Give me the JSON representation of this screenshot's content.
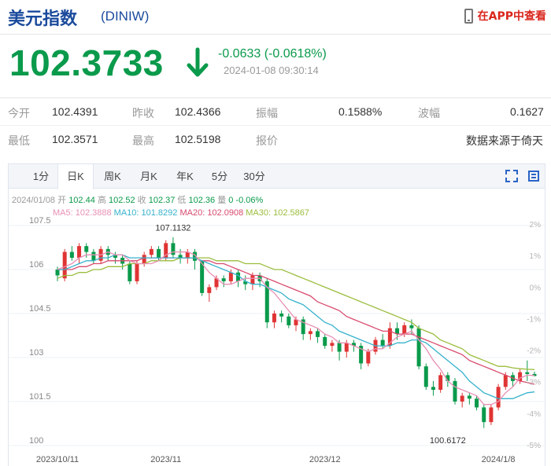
{
  "header": {
    "title": "美元指数",
    "code": "(DINIW)",
    "app_link": "在APP中查看"
  },
  "quote": {
    "price": "102.3733",
    "change": "-0.0633 (-0.0618%)",
    "time": "2024-01-08 09:30:14"
  },
  "stats": [
    {
      "label": "今开",
      "value": "102.4391"
    },
    {
      "label": "昨收",
      "value": "102.4366"
    },
    {
      "label": "振幅",
      "value": "0.1588%"
    },
    {
      "label": "波幅",
      "value": "0.1627"
    },
    {
      "label": "最低",
      "value": "102.3571"
    },
    {
      "label": "最高",
      "value": "102.5198"
    },
    {
      "label": "报价",
      "value": ""
    },
    {
      "label": "",
      "value": "数据来源于倚天"
    }
  ],
  "tabs": [
    "1分",
    "日K",
    "周K",
    "月K",
    "年K",
    "5分",
    "30分"
  ],
  "active_tab": "日K",
  "colors": {
    "up": "#e03434",
    "down": "#0a9a4b",
    "ma5": "#e88fb4",
    "ma10": "#35b2cc",
    "ma20": "#d94a6e",
    "ma30": "#9bbd3d"
  },
  "chart_data": {
    "type": "candlestick",
    "info_date": "2024/01/08",
    "info_items": [
      {
        "label": "开",
        "value": "102.44"
      },
      {
        "label": "高",
        "value": "102.52"
      },
      {
        "label": "收",
        "value": "102.37"
      },
      {
        "label": "低",
        "value": "102.36"
      },
      {
        "label": "量",
        "value": "0"
      },
      {
        "label": "",
        "value": "-0.06%"
      }
    ],
    "ma_labels": [
      {
        "name": "MA5",
        "value": "102.3888"
      },
      {
        "name": "MA10",
        "value": "101.8292"
      },
      {
        "name": "MA20",
        "value": "102.0908"
      },
      {
        "name": "MA30",
        "value": "102.5867"
      }
    ],
    "y_ticks": [
      "107.5",
      "106",
      "104.5",
      "103",
      "101.5",
      "100"
    ],
    "y_tick_values": [
      107.5,
      106,
      104.5,
      103,
      101.5,
      100
    ],
    "pct_ticks": [
      "2%",
      "1%",
      "0%",
      "-1%",
      "-2%",
      "-3%",
      "-4%",
      "-5%"
    ],
    "x_ticks": [
      {
        "label": "2023/10/11",
        "index": 0
      },
      {
        "label": "2023/11",
        "index": 15
      },
      {
        "label": "2023/12",
        "index": 37
      },
      {
        "label": "2024/1/8",
        "index": 61
      }
    ],
    "ylim": [
      100,
      107.5
    ],
    "annotations": [
      {
        "label": "107.1132",
        "index": 16,
        "value": 107.11
      },
      {
        "label": "100.6172",
        "index": 54,
        "value": 100.62
      }
    ],
    "candles": [
      [
        106.0,
        105.8,
        106.1,
        105.6
      ],
      [
        105.7,
        106.6,
        106.7,
        105.6
      ],
      [
        106.6,
        106.4,
        106.8,
        106.3
      ],
      [
        106.4,
        106.8,
        106.9,
        106.2
      ],
      [
        106.8,
        106.6,
        106.9,
        106.4
      ],
      [
        106.6,
        106.3,
        106.7,
        106.2
      ],
      [
        106.3,
        106.7,
        106.8,
        106.2
      ],
      [
        106.7,
        106.5,
        106.8,
        106.3
      ],
      [
        106.5,
        106.4,
        106.6,
        106.2
      ],
      [
        106.4,
        106.2,
        106.5,
        106.0
      ],
      [
        106.2,
        105.6,
        106.3,
        105.5
      ],
      [
        105.6,
        106.2,
        106.3,
        105.5
      ],
      [
        106.2,
        106.5,
        106.6,
        106.1
      ],
      [
        106.5,
        106.7,
        106.8,
        106.4
      ],
      [
        106.7,
        106.4,
        106.8,
        106.3
      ],
      [
        106.4,
        106.9,
        107.0,
        106.3
      ],
      [
        106.9,
        106.5,
        107.1,
        106.4
      ],
      [
        106.5,
        106.4,
        106.7,
        106.2
      ],
      [
        106.4,
        106.6,
        106.7,
        106.2
      ],
      [
        106.6,
        106.3,
        106.7,
        106.0
      ],
      [
        106.3,
        105.2,
        106.3,
        105.1
      ],
      [
        105.2,
        105.4,
        105.5,
        104.9
      ],
      [
        105.4,
        105.7,
        105.8,
        105.3
      ],
      [
        105.7,
        105.6,
        105.8,
        105.4
      ],
      [
        105.6,
        105.9,
        106.0,
        105.5
      ],
      [
        105.9,
        105.6,
        106.0,
        105.4
      ],
      [
        105.6,
        105.5,
        105.8,
        105.3
      ],
      [
        105.5,
        105.8,
        105.9,
        105.3
      ],
      [
        105.8,
        105.6,
        105.9,
        105.4
      ],
      [
        105.6,
        104.2,
        105.7,
        104.0
      ],
      [
        104.2,
        104.5,
        104.6,
        104.0
      ],
      [
        104.5,
        104.4,
        104.6,
        104.2
      ],
      [
        104.4,
        104.1,
        104.5,
        104.0
      ],
      [
        104.1,
        104.3,
        104.4,
        103.9
      ],
      [
        104.3,
        103.8,
        104.4,
        103.6
      ],
      [
        103.8,
        103.9,
        104.0,
        103.6
      ],
      [
        103.9,
        103.7,
        104.0,
        103.5
      ],
      [
        103.7,
        103.4,
        103.8,
        103.3
      ],
      [
        103.4,
        103.5,
        103.6,
        103.2
      ],
      [
        103.5,
        103.2,
        103.6,
        102.9
      ],
      [
        103.2,
        103.5,
        103.6,
        103.0
      ],
      [
        103.5,
        103.4,
        103.6,
        103.2
      ],
      [
        103.4,
        102.8,
        103.5,
        102.6
      ],
      [
        102.8,
        103.2,
        103.3,
        102.7
      ],
      [
        103.2,
        103.6,
        103.7,
        103.1
      ],
      [
        103.6,
        103.4,
        103.8,
        103.3
      ],
      [
        103.4,
        104.0,
        104.2,
        103.3
      ],
      [
        104.0,
        103.8,
        104.2,
        103.6
      ],
      [
        103.8,
        104.1,
        104.2,
        103.7
      ],
      [
        104.1,
        104.0,
        104.3,
        103.8
      ],
      [
        104.0,
        102.7,
        104.1,
        102.6
      ],
      [
        102.7,
        102.0,
        102.8,
        101.9
      ],
      [
        102.0,
        101.9,
        102.2,
        101.7
      ],
      [
        101.9,
        102.4,
        102.5,
        101.8
      ],
      [
        102.4,
        102.2,
        102.5,
        102.0
      ],
      [
        102.2,
        101.5,
        102.3,
        101.4
      ],
      [
        101.5,
        101.7,
        101.8,
        101.3
      ],
      [
        101.7,
        101.6,
        101.8,
        101.4
      ],
      [
        101.6,
        101.3,
        101.7,
        101.2
      ],
      [
        101.3,
        100.8,
        101.4,
        100.6
      ],
      [
        100.8,
        101.3,
        101.4,
        100.7
      ],
      [
        101.3,
        102.0,
        102.1,
        101.2
      ],
      [
        102.0,
        102.4,
        102.5,
        101.9
      ],
      [
        102.4,
        102.2,
        102.5,
        102.0
      ],
      [
        102.2,
        102.5,
        102.6,
        102.1
      ],
      [
        102.5,
        102.44,
        102.9,
        102.2
      ],
      [
        102.44,
        102.37,
        102.52,
        102.36
      ]
    ],
    "ma": {
      "ma5": [
        106.0,
        106.1,
        106.2,
        106.4,
        106.5,
        106.5,
        106.5,
        106.6,
        106.5,
        106.5,
        106.3,
        106.2,
        106.2,
        106.2,
        106.3,
        106.5,
        106.6,
        106.6,
        106.6,
        106.5,
        106.2,
        105.9,
        105.7,
        105.5,
        105.5,
        105.6,
        105.7,
        105.7,
        105.7,
        105.4,
        105.2,
        104.9,
        104.6,
        104.3,
        104.2,
        104.1,
        104.0,
        103.8,
        103.7,
        103.5,
        103.5,
        103.4,
        103.3,
        103.2,
        103.3,
        103.3,
        103.5,
        103.7,
        103.8,
        103.9,
        103.6,
        103.3,
        102.9,
        102.6,
        102.2,
        102.0,
        101.9,
        101.8,
        101.7,
        101.4,
        101.4,
        101.5,
        101.8,
        102.0,
        102.3,
        102.4,
        102.39
      ],
      "ma10": [
        106.0,
        106.0,
        106.1,
        106.2,
        106.3,
        106.3,
        106.4,
        106.4,
        106.5,
        106.5,
        106.4,
        106.4,
        106.4,
        106.4,
        106.4,
        106.4,
        106.4,
        106.4,
        106.4,
        106.4,
        106.3,
        106.2,
        106.1,
        106.0,
        105.9,
        105.8,
        105.6,
        105.5,
        105.5,
        105.4,
        105.3,
        105.2,
        105.0,
        104.9,
        104.8,
        104.6,
        104.4,
        104.2,
        104.1,
        103.9,
        103.8,
        103.7,
        103.6,
        103.5,
        103.4,
        103.4,
        103.4,
        103.5,
        103.5,
        103.6,
        103.6,
        103.5,
        103.3,
        103.1,
        102.9,
        102.7,
        102.5,
        102.2,
        102.0,
        101.8,
        101.7,
        101.6,
        101.6,
        101.6,
        101.7,
        101.8,
        101.83
      ],
      "ma20": [
        106.0,
        106.0,
        106.0,
        106.1,
        106.1,
        106.2,
        106.2,
        106.3,
        106.3,
        106.3,
        106.3,
        106.3,
        106.4,
        106.4,
        106.4,
        106.4,
        106.4,
        106.4,
        106.4,
        106.4,
        106.3,
        106.3,
        106.2,
        106.2,
        106.1,
        106.0,
        105.9,
        105.8,
        105.8,
        105.7,
        105.6,
        105.5,
        105.4,
        105.3,
        105.2,
        105.1,
        104.9,
        104.8,
        104.7,
        104.6,
        104.4,
        104.3,
        104.2,
        104.1,
        104.0,
        103.9,
        103.9,
        103.8,
        103.8,
        103.8,
        103.7,
        103.6,
        103.5,
        103.4,
        103.3,
        103.2,
        103.1,
        102.9,
        102.8,
        102.7,
        102.6,
        102.5,
        102.4,
        102.3,
        102.2,
        102.15,
        102.09
      ],
      "ma30": [
        105.7,
        105.8,
        105.8,
        105.9,
        105.9,
        106.0,
        106.0,
        106.1,
        106.1,
        106.1,
        106.2,
        106.2,
        106.2,
        106.3,
        106.3,
        106.3,
        106.3,
        106.4,
        106.4,
        106.4,
        106.4,
        106.4,
        106.3,
        106.3,
        106.3,
        106.3,
        106.2,
        106.2,
        106.2,
        106.1,
        106.0,
        106.0,
        105.9,
        105.8,
        105.7,
        105.6,
        105.5,
        105.4,
        105.3,
        105.2,
        105.1,
        105.0,
        104.9,
        104.8,
        104.7,
        104.6,
        104.5,
        104.4,
        104.3,
        104.2,
        104.0,
        103.9,
        103.8,
        103.6,
        103.5,
        103.4,
        103.3,
        103.1,
        103.0,
        102.9,
        102.8,
        102.7,
        102.7,
        102.65,
        102.62,
        102.6,
        102.59
      ]
    }
  }
}
